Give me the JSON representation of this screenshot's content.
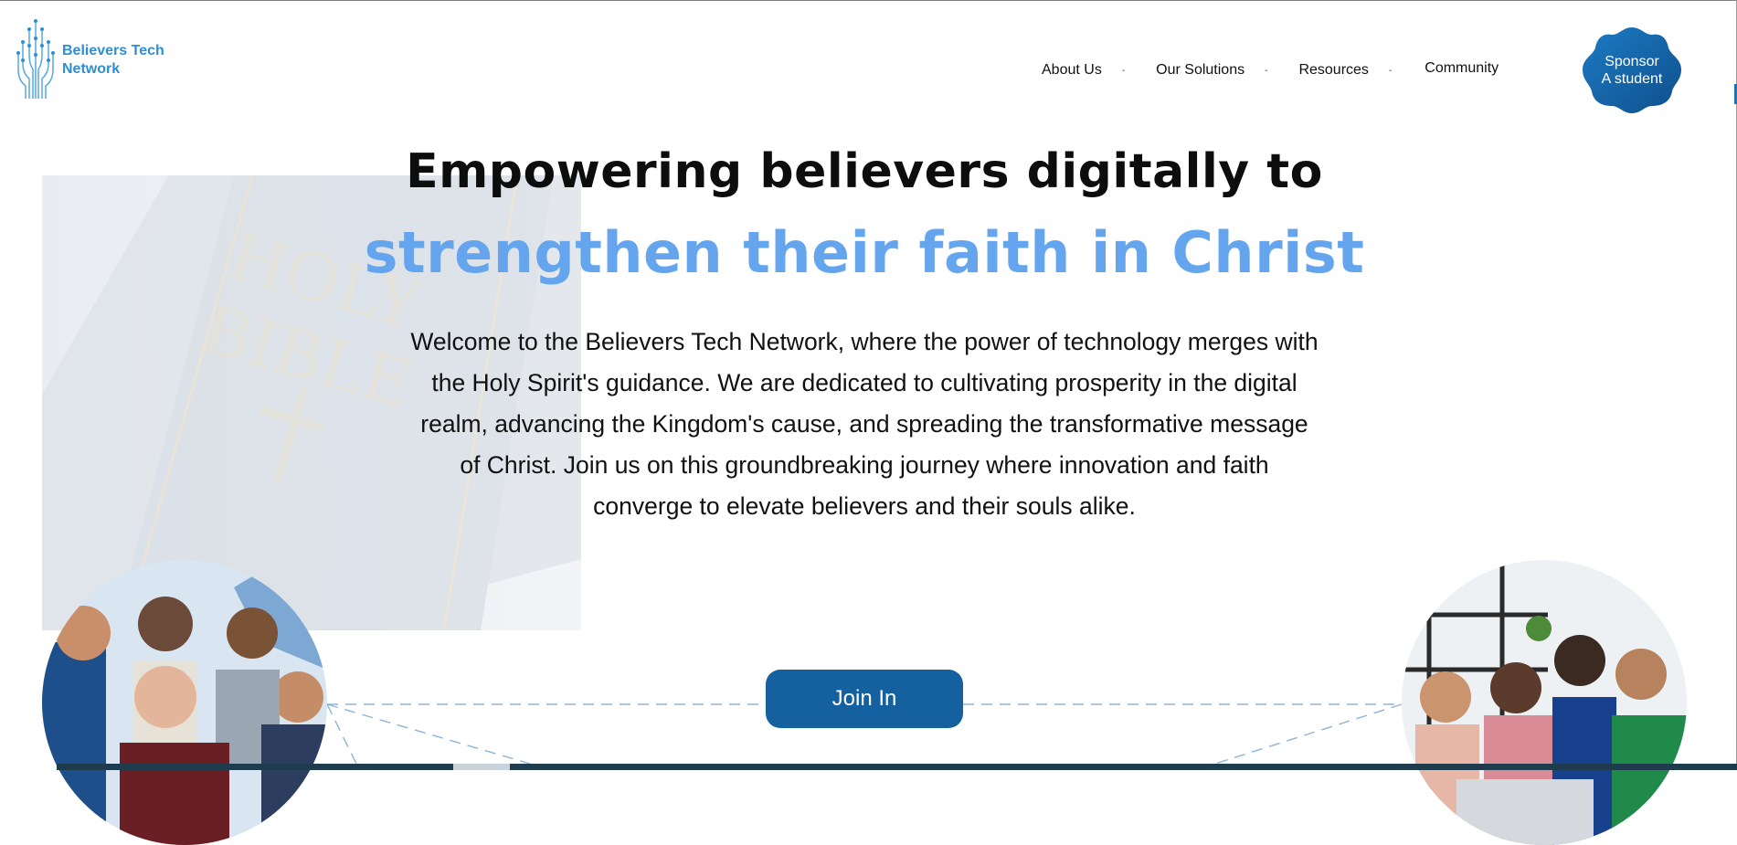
{
  "brand": {
    "name_line1": "Believers Tech",
    "name_line2": "Network",
    "color": "#2b8fd6",
    "logo_icon": "circuit-tree-icon"
  },
  "nav": {
    "items": [
      {
        "label": "About Us",
        "has_dropdown": true
      },
      {
        "label": "Our Solutions",
        "has_dropdown": true
      },
      {
        "label": "Resources",
        "has_dropdown": true
      },
      {
        "label": "Community",
        "has_dropdown": false
      }
    ],
    "caret": "-",
    "sponsor_line1": "Sponsor",
    "sponsor_line2": "A student",
    "sponsor_color": "#1565a8"
  },
  "hero": {
    "headline_line1": "Empowering believers digitally to",
    "headline_line2": "strengthen their faith in Christ",
    "headline_accent_color": "#64a5ee",
    "intro": "Welcome to the Believers Tech Network, where the power of technology merges with the Holy Spirit's guidance. We are dedicated to cultivating prosperity in the digital realm, advancing the Kingdom's cause, and spreading the transformative message of Christ. Join us on this groundbreaking journey where innovation and faith converge to elevate believers and their souls alike.",
    "background_book": {
      "line1": "HOLY",
      "line2": "BIBLE"
    }
  },
  "cta": {
    "join_label": "Join In",
    "color": "#1561a0"
  }
}
